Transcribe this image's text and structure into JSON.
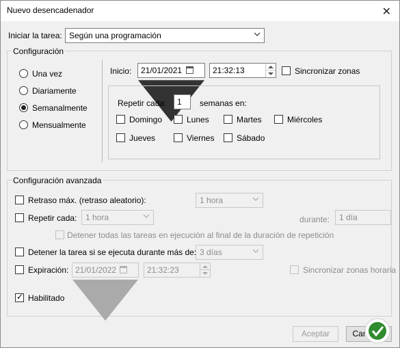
{
  "window": {
    "title": "Nuevo desencadenador",
    "close_symbol": "✕"
  },
  "start_task": {
    "label": "Iniciar la tarea:",
    "value": "Según una programación"
  },
  "config": {
    "heading": "Configuración",
    "schedule_options": [
      {
        "label": "Una vez",
        "selected": false
      },
      {
        "label": "Diariamente",
        "selected": false
      },
      {
        "label": "Semanalmente",
        "selected": true
      },
      {
        "label": "Mensualmente",
        "selected": false
      }
    ],
    "start_label": "Inicio:",
    "start_date": "21/01/2021",
    "start_time": "21:32:13",
    "sync_zones_label": "Sincronizar zonas",
    "repeat_every_label": "Repetir cada:",
    "repeat_every_value": "1",
    "weeks_on_label": "semanas en:",
    "days": [
      {
        "label": "Domingo",
        "checked": false
      },
      {
        "label": "Lunes",
        "checked": false
      },
      {
        "label": "Martes",
        "checked": false
      },
      {
        "label": "Miércoles",
        "checked": false
      },
      {
        "label": "Jueves",
        "checked": false
      },
      {
        "label": "Viernes",
        "checked": false
      },
      {
        "label": "Sábado",
        "checked": false
      }
    ]
  },
  "advanced": {
    "heading": "Configuración avanzada",
    "delay_label": "Retraso máx. (retraso aleatorio):",
    "delay_value": "1 hora",
    "repeat_label": "Repetir cada:",
    "repeat_value": "1 hora",
    "duration_label": "durante:",
    "duration_value": "1 día",
    "stop_all_label": "Detener todas las tareas en ejecución al final de la duración de repetición",
    "stop_if_label": "Detener la tarea si se ejecuta durante más de:",
    "stop_if_value": "3 días",
    "expiration_label": "Expiración:",
    "expiration_date": "21/01/2022",
    "expiration_time": "21:32:23",
    "sync_zones_expiration_label": "Sincronizar zonas horaria",
    "enabled_label": "Habilitado",
    "enabled_checked": true
  },
  "buttons": {
    "accept": "Aceptar",
    "cancel": "Cancelar"
  },
  "check_symbol": "✓"
}
